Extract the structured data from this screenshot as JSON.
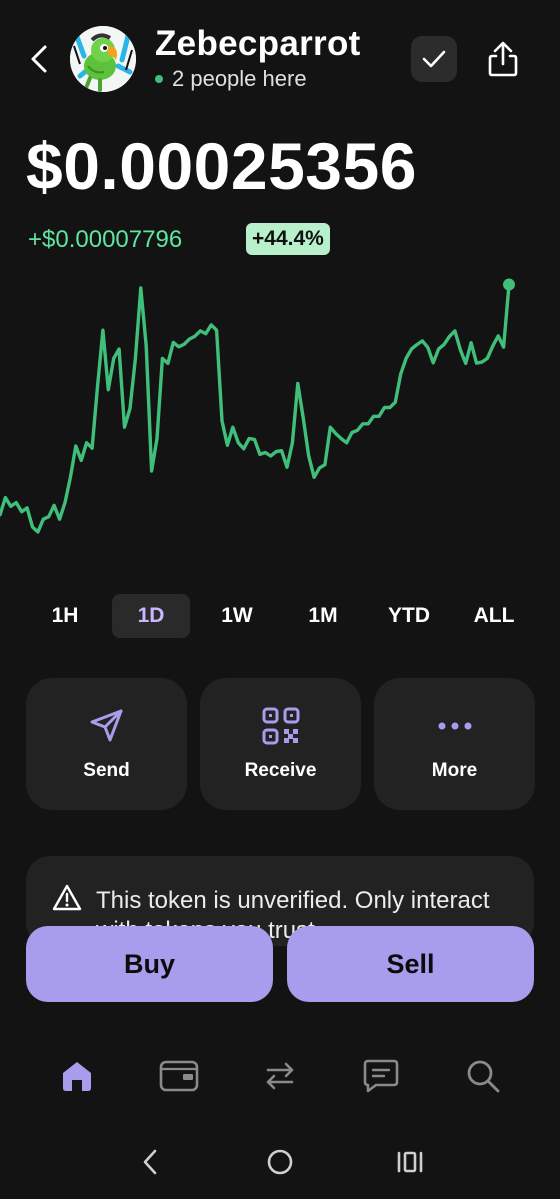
{
  "header": {
    "token_name": "Zebecparrot",
    "presence_text": "2 people here"
  },
  "price": {
    "current": "$0.00025356",
    "change_abs": "+$0.00007796",
    "change_pct": "+44.4%"
  },
  "chart_data": {
    "type": "line",
    "series": [
      {
        "color": "#3fbf7a",
        "values": [
          0.00018,
          0.0001855,
          0.0001827,
          0.0001839,
          0.000181,
          0.0001822,
          0.0001761,
          0.0001745,
          0.0001786,
          0.0001794,
          0.000183,
          0.0001786,
          0.0001839,
          0.000192,
          0.000202,
          0.0001974,
          0.000203,
          0.0002013,
          0.000221,
          0.000239,
          0.00022,
          0.00023,
          0.000233,
          0.000208,
          0.000214,
          0.00023,
          0.0002525,
          0.000234,
          0.000194,
          0.0002044,
          0.00023,
          0.0002284,
          0.0002351,
          0.0002337,
          0.0002345,
          0.0002362,
          0.0002371,
          0.0002388,
          0.0002379,
          0.0002407,
          0.000239,
          0.00021,
          0.0002022,
          0.000208,
          0.000203,
          0.0002011,
          0.0002044,
          0.0002041,
          0.0001993,
          0.0001999,
          0.0001988,
          0.0002002,
          0.0002005,
          0.0001952,
          0.000203,
          0.000222,
          0.000211,
          0.000199,
          0.000192,
          0.000195,
          0.000196,
          0.000208,
          0.000206,
          0.0002044,
          0.000203,
          0.0002063,
          0.000207,
          0.0002091,
          0.0002091,
          0.0002115,
          0.0002115,
          0.0002143,
          0.0002143,
          0.000216,
          0.000225,
          0.00023,
          0.000233,
          0.0002344,
          0.0002356,
          0.0002335,
          0.0002286,
          0.000233,
          0.0002344,
          0.000237,
          0.0002388,
          0.0002328,
          0.0002284,
          0.000235,
          0.0002285,
          0.0002288,
          0.00023,
          0.000234,
          0.0002372,
          0.0002336,
          0.0002536
        ]
      }
    ]
  },
  "ranges": {
    "items": [
      "1H",
      "1D",
      "1W",
      "1M",
      "YTD",
      "ALL"
    ],
    "active": "1D"
  },
  "actions": {
    "send": "Send",
    "receive": "Receive",
    "more": "More"
  },
  "warning": {
    "text": "This token is unverified. Only interact with tokens you trust."
  },
  "trade": {
    "buy": "Buy",
    "sell": "Sell"
  },
  "colors": {
    "accent": "#a89ded",
    "positive": "#3fbf7a",
    "positive_text": "#5ee6a0",
    "badge_bg": "#b8f0cc",
    "background": "#131313",
    "card": "#222222"
  }
}
